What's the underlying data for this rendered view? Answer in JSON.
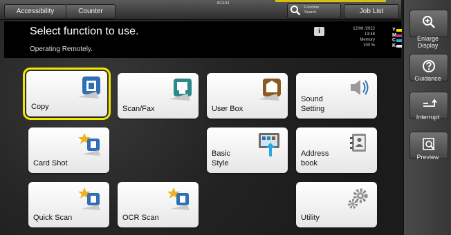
{
  "topbar": {
    "accessibility": "Accessibility",
    "counter": "Counter",
    "serial": "8CE83",
    "function_search": [
      "Function",
      "Search"
    ],
    "job_list": "Job List"
  },
  "status": {
    "title": "Select function to use.",
    "subtitle": "Operating Remotely.",
    "date": "12/06 /2022",
    "time": "13:48",
    "memory": "Memory",
    "memory_pct": "100 %",
    "toner": [
      "Y",
      "M",
      "C",
      "K"
    ],
    "toner_colors": [
      "#f0e000",
      "#d22a8b",
      "#2aa7e0",
      "#eaeaea"
    ]
  },
  "right_panel": {
    "enlarge": [
      "Enlarge",
      "Display"
    ],
    "guidance": "Guidance",
    "interrupt": "Interrupt",
    "preview": "Preview"
  },
  "tiles": {
    "copy": "Copy",
    "scan_fax": "Scan/Fax",
    "user_box": "User Box",
    "sound_setting": [
      "Sound",
      "Setting"
    ],
    "card_shot": "Card Shot",
    "basic_style": [
      "Basic",
      "Style"
    ],
    "address_book": [
      "Address",
      "book"
    ],
    "quick_scan": "Quick Scan",
    "ocr_scan": "OCR Scan",
    "utility": "Utility"
  },
  "colors": {
    "selection": "#f5e800",
    "accent": "#2f6fb3"
  }
}
